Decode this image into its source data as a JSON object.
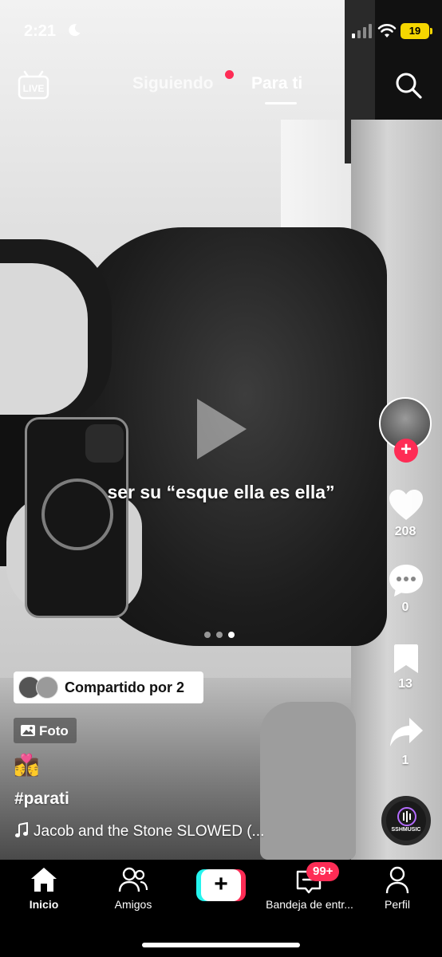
{
  "status_bar": {
    "time": "2:21",
    "battery": "19"
  },
  "top_nav": {
    "live_label": "LIVE",
    "following_tab": "Siguiendo",
    "for_you_tab": "Para ti"
  },
  "post": {
    "caption_overlay": "ser su “esque ella es ella”",
    "carousel": {
      "count": 3,
      "active_index": 2
    },
    "shared_by": "Compartido por 2",
    "media_type": "Foto",
    "emoji": "👩‍❤️‍💋‍👩",
    "hashtag": "#parati",
    "sound": "Jacob and the Stone SLOWED (..."
  },
  "right_rail": {
    "likes": "208",
    "comments": "0",
    "bookmarks": "13",
    "shares": "1",
    "music_label": "SSHMUSIC"
  },
  "bottom_nav": {
    "home": "Inicio",
    "friends": "Amigos",
    "inbox": "Bandeja de entr...",
    "inbox_badge": "99+",
    "profile": "Perfil"
  },
  "colors": {
    "accent": "#fe2c55",
    "cyan": "#25f4ee",
    "battery": "#f5d600"
  }
}
